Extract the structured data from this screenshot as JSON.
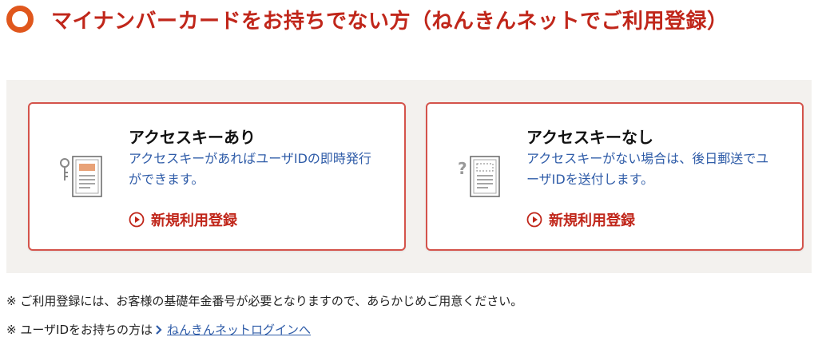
{
  "heading": {
    "title": "マイナンバーカードをお持ちでない方（ねんきんネットでご利用登録）"
  },
  "cards": [
    {
      "title": "アクセスキーあり",
      "description": "アクセスキーがあればユーザIDの即時発行ができます。",
      "link_label": "新規利用登録",
      "icon": "key-document-icon"
    },
    {
      "title": "アクセスキーなし",
      "description": "アクセスキーがない場合は、後日郵送でユーザIDを送付します。",
      "link_label": "新規利用登録",
      "icon": "question-document-icon"
    }
  ],
  "notes": {
    "note1": "※ ご利用登録には、お客様の基礎年金番号が必要となりますので、あらかじめご用意ください。",
    "note2_prefix": "※ ユーザIDをお持ちの方は",
    "note2_link": "ねんきんネットログインへ"
  },
  "colors": {
    "accent_red": "#c0261a",
    "ring_orange": "#e0571d",
    "link_blue": "#2f5ca8",
    "card_border": "#d4534b",
    "panel_bg": "#f3f1ee"
  }
}
